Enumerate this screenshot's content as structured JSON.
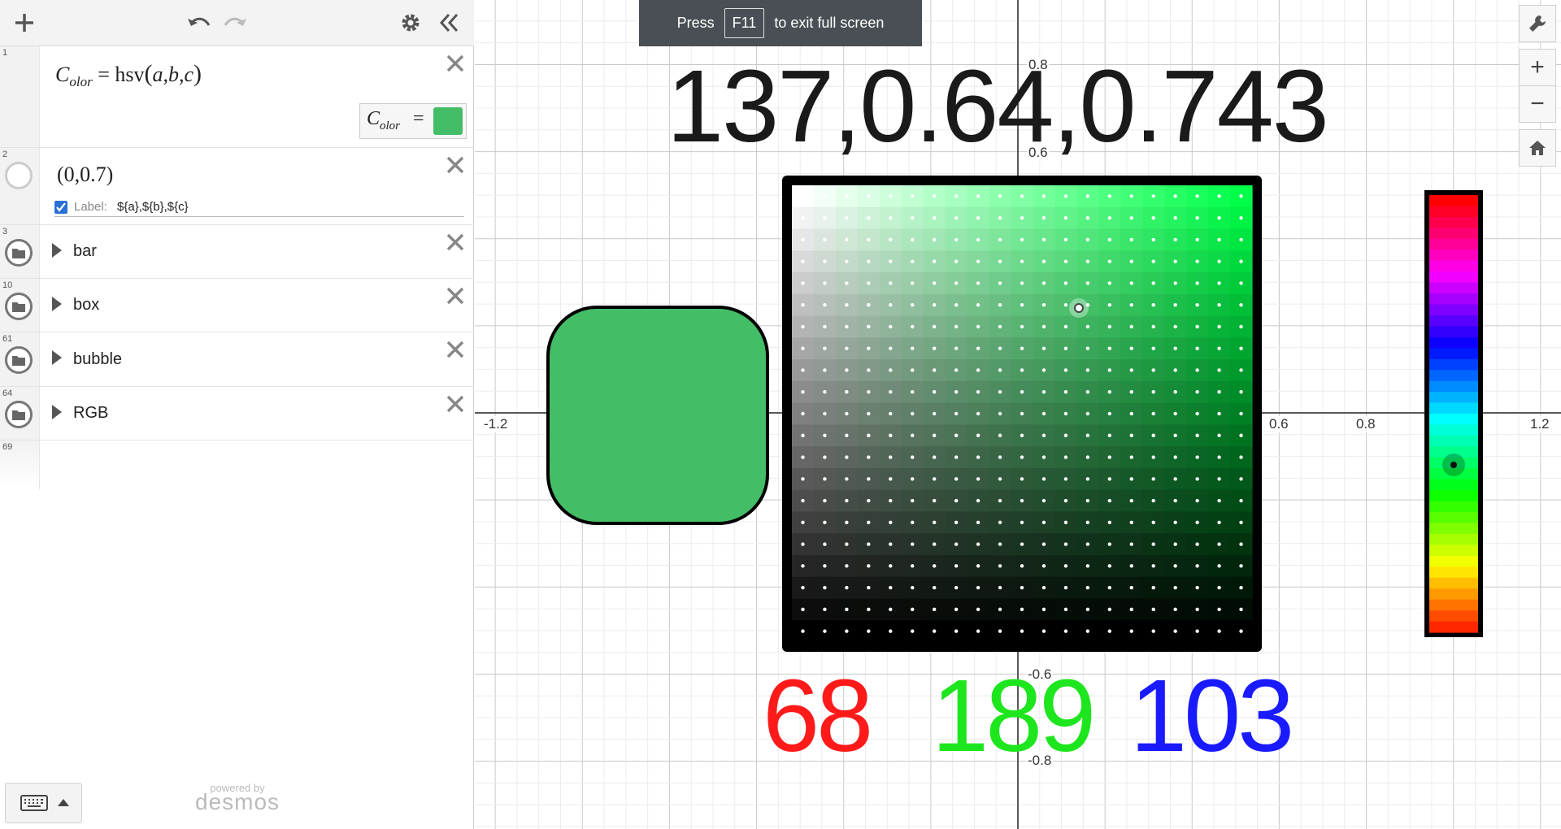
{
  "toolbar": {
    "add_icon": "plus-icon",
    "undo_icon": "undo-icon",
    "redo_icon": "redo-icon",
    "settings_icon": "gear-icon",
    "collapse_icon": "double-chevron-left-icon"
  },
  "expressions": [
    {
      "num": "1",
      "lhs_main": "C",
      "lhs_sub": "olor",
      "rhs_fn": "hsv",
      "rhs_args": "a,b,c",
      "preview_lhs_main": "C",
      "preview_lhs_sub": "olor",
      "preview_eq": "=",
      "swatch_color": "#44bd67"
    },
    {
      "num": "2",
      "point": "(0,0.7)",
      "label_checkbox": "Label:",
      "label_text": "${a},${b},${c}"
    },
    {
      "num": "3",
      "folder": "bar"
    },
    {
      "num": "10",
      "folder": "box"
    },
    {
      "num": "61",
      "folder": "bubble"
    },
    {
      "num": "64",
      "folder": "RGB"
    },
    {
      "num": "69"
    }
  ],
  "fullscreen_toast": {
    "press": "Press",
    "key": "F11",
    "rest": "to exit full screen"
  },
  "graph": {
    "big_label": "137,0.64,0.743",
    "rgb": {
      "r": "68",
      "g": "189",
      "b": "103"
    },
    "rgb_colors": {
      "r": "#ff1a1a",
      "g": "#1ee61e",
      "b": "#1a1aff"
    },
    "y_ticks": [
      "0.8",
      "0.6",
      "-0.6",
      "-0.8"
    ],
    "x_ticks": [
      "-1.2",
      "0.6",
      "0.8",
      "1.2"
    ],
    "hue_picker_value": 0.37,
    "sv_picker": {
      "s": 0.64,
      "v": 0.743
    }
  },
  "right_controls": {
    "wrench_icon": "wrench-icon",
    "zoom_in": "+",
    "zoom_out": "−",
    "home_icon": "home-icon"
  },
  "footer": {
    "powered": "powered by",
    "brand": "desmos",
    "keyboard_icon": "keyboard-icon"
  }
}
